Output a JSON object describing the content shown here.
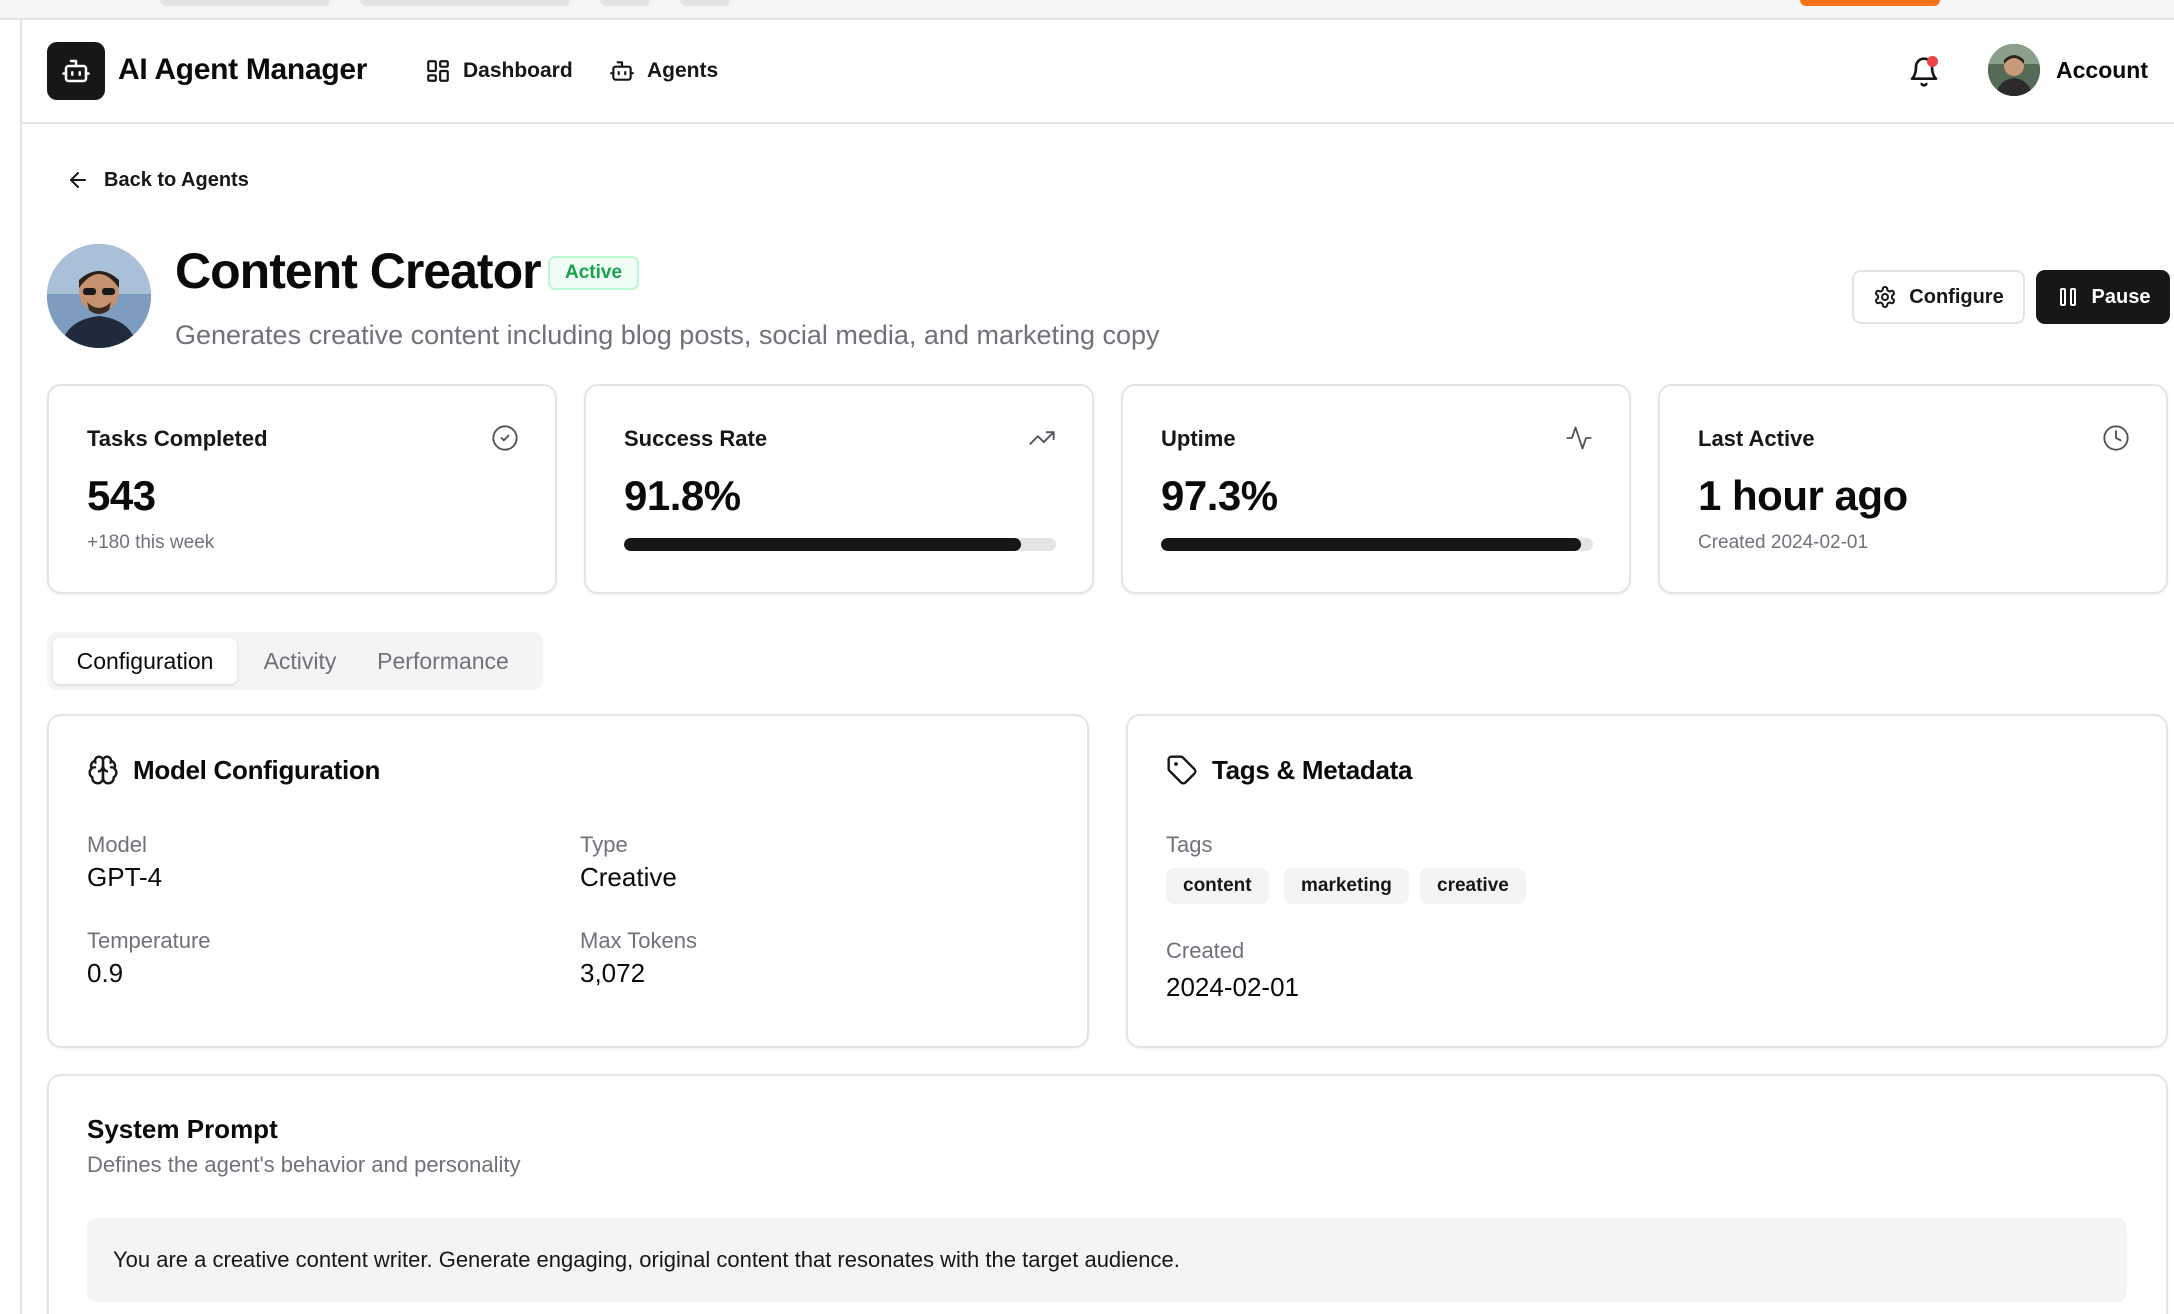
{
  "header": {
    "app_title": "AI Agent Manager",
    "nav": [
      {
        "label": "Dashboard",
        "icon": "dashboard-icon"
      },
      {
        "label": "Agents",
        "icon": "bot-icon"
      }
    ],
    "account_label": "Account",
    "has_notification": true
  },
  "back_link": "Back to Agents",
  "agent": {
    "name": "Content Creator",
    "status": "Active",
    "description": "Generates creative content including blog posts, social media, and marketing copy"
  },
  "actions": {
    "configure_label": "Configure",
    "pause_label": "Pause"
  },
  "stats": {
    "tasks": {
      "label": "Tasks Completed",
      "value": "543",
      "sub": "+180 this week"
    },
    "success": {
      "label": "Success Rate",
      "value": "91.8%",
      "progress": 0.918
    },
    "uptime": {
      "label": "Uptime",
      "value": "97.3%",
      "progress": 0.973
    },
    "last_active": {
      "label": "Last Active",
      "value": "1 hour ago",
      "sub": "Created 2024-02-01"
    }
  },
  "tabs": [
    {
      "label": "Configuration",
      "active": true
    },
    {
      "label": "Activity",
      "active": false
    },
    {
      "label": "Performance",
      "active": false
    }
  ],
  "model_config": {
    "title": "Model Configuration",
    "model_label": "Model",
    "model_value": "GPT-4",
    "type_label": "Type",
    "type_value": "Creative",
    "temperature_label": "Temperature",
    "temperature_value": "0.9",
    "max_tokens_label": "Max Tokens",
    "max_tokens_value": "3,072"
  },
  "tags_meta": {
    "title": "Tags & Metadata",
    "tags_label": "Tags",
    "tags": [
      "content",
      "marketing",
      "creative"
    ],
    "created_label": "Created",
    "created_value": "2024-02-01"
  },
  "system_prompt": {
    "title": "System Prompt",
    "description": "Defines the agent's behavior and personality",
    "text": "You are a creative content writer. Generate engaging, original content that resonates with the target audience."
  },
  "colors": {
    "primary": "#171717",
    "active_green": "#16a34a",
    "notification_red": "#ef4444",
    "muted_text": "#71717a",
    "border": "#e4e4e7"
  }
}
